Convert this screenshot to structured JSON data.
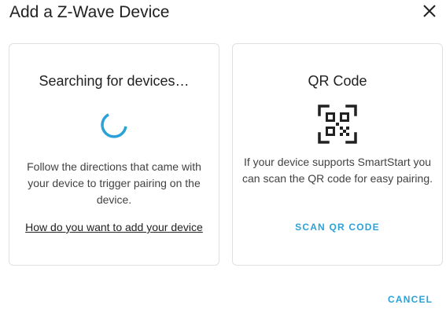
{
  "dialog": {
    "title": "Add a Z-Wave Device",
    "close_icon": "close-icon",
    "cancel_label": "CANCEL"
  },
  "search_card": {
    "title": "Searching for devices…",
    "spinner_icon": "loading-spinner-icon",
    "description": "Follow the directions that came with your device to trigger pairing on the device.",
    "help_link": "How do you want to add your device"
  },
  "qr_card": {
    "title": "QR Code",
    "qr_icon": "qr-code-scan-icon",
    "description": "If your device supports SmartStart you can scan the QR code for easy pairing.",
    "scan_label": "SCAN QR CODE"
  },
  "colors": {
    "accent": "#2aa2d8",
    "spinner": "#2aa2d8",
    "text_primary": "#212121",
    "border": "#e0e0e0"
  }
}
